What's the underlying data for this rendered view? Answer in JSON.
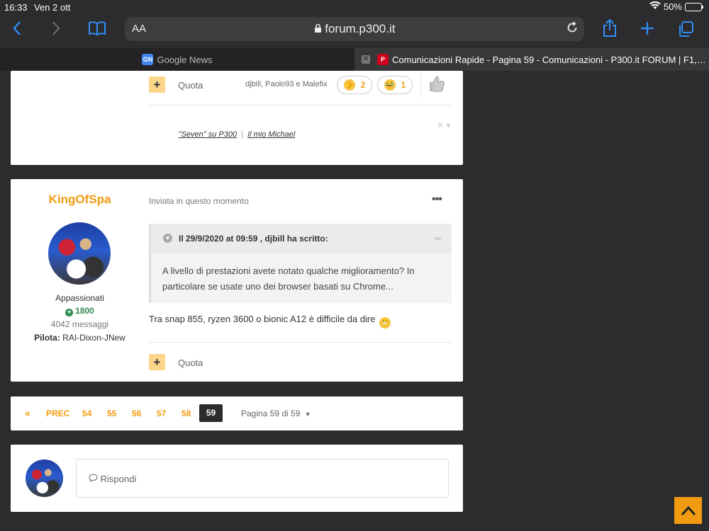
{
  "status": {
    "time": "16:33",
    "date": "Ven 2 ott",
    "battery": "50%",
    "battery_level": 0.5
  },
  "browser": {
    "url": "forum.p300.it",
    "aa": "AA",
    "tabs": [
      {
        "label": "Google News",
        "favicon": "GN"
      },
      {
        "label": "Comunicazioni Rapide - Pagina 59 - Comunicazioni - P300.it FORUM | F1,…",
        "favicon": "P"
      }
    ]
  },
  "post1": {
    "quote_label": "Quota",
    "reactors": "djbill, Paolo93 e Malefix",
    "reactions": [
      {
        "emoji": "thumbs-up",
        "count": "2"
      },
      {
        "emoji": "laugh",
        "count": "1"
      }
    ],
    "signature": {
      "link1": "\"Seven\" su P300",
      "sep": "|",
      "link2": "Il mio Michael"
    }
  },
  "post2": {
    "author": "KingOfSpa",
    "group": "Appassionati",
    "reputation": "1800",
    "posts": "4042 messaggi",
    "pilota_label": "Pilota:",
    "pilota_value": "RAI-Dixon-JNew",
    "sent": "Inviata in questo momento",
    "quote": {
      "title": "Il 29/9/2020 at 09:59 , djbill ha scritto:",
      "text": "A livello di prestazioni avete notato qualche miglioramento? In particolare se usate uno dei browser basati su Chrome..."
    },
    "answer": "Tra snap 855, ryzen 3600 o bionic A12 è difficile da dire",
    "quote_label": "Quota"
  },
  "pagination": {
    "prev_icon": "«",
    "prev": "PREC",
    "pages": [
      "54",
      "55",
      "56",
      "57",
      "58"
    ],
    "current": "59",
    "info": "Pagina 59 di 59"
  },
  "reply": {
    "placeholder": "Rispondi"
  }
}
